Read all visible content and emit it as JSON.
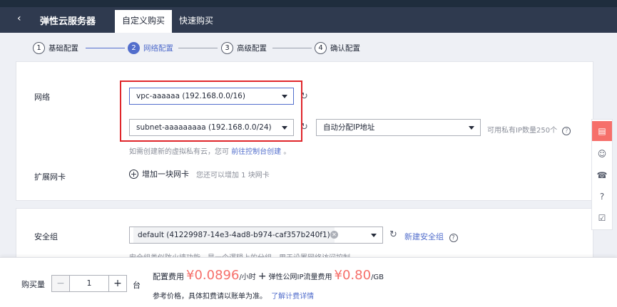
{
  "header": {
    "title": "弹性云服务器",
    "tabs": [
      {
        "label": "自定义购买",
        "active": true
      },
      {
        "label": "快速购买",
        "active": false
      }
    ]
  },
  "steps": [
    {
      "num": "1",
      "label": "基础配置"
    },
    {
      "num": "2",
      "label": "网络配置",
      "active": true
    },
    {
      "num": "3",
      "label": "高级配置"
    },
    {
      "num": "4",
      "label": "确认配置"
    }
  ],
  "network": {
    "label": "网络",
    "vpc_value": "vpc-aaaaaa (192.168.0.0/16)",
    "subnet_value": "subnet-aaaaaaaaa (192.168.0.0/24)",
    "ip_value": "自动分配IP地址",
    "ip_available": "可用私有IP数量250个",
    "hint_prefix": "如需创建新的虚拟私有云，您可",
    "hint_link": "前往控制台创建",
    "hint_suffix": "。"
  },
  "nic": {
    "label": "扩展网卡",
    "add_label": "增加一块网卡",
    "hint": "您还可以增加 1 块网卡"
  },
  "security": {
    "label": "安全组",
    "value": "default (41229987-14e3-4ad8-b974-caf357b240f1)",
    "new_link": "新建安全组",
    "hint": "安全组类似防火墙功能，是一个逻辑上的分组，用于设置网络访问控制"
  },
  "footer": {
    "qty_label": "购买量",
    "qty_value": "1",
    "qty_unit": "台",
    "config_label": "配置费用",
    "config_price": "¥0.0896",
    "config_unit": "/小时",
    "plus": "+",
    "traffic_label": "弹性公网IP流量费用",
    "traffic_price": "¥0.80",
    "traffic_unit": "/GB",
    "note": "参考价格，具体扣费请以账单为准。",
    "note_link": "了解计费详情"
  },
  "colors": {
    "accent": "#526ecc",
    "price": "#f66f6a",
    "highlight": "#e0262b",
    "header_bg": "#2f3a4f"
  }
}
